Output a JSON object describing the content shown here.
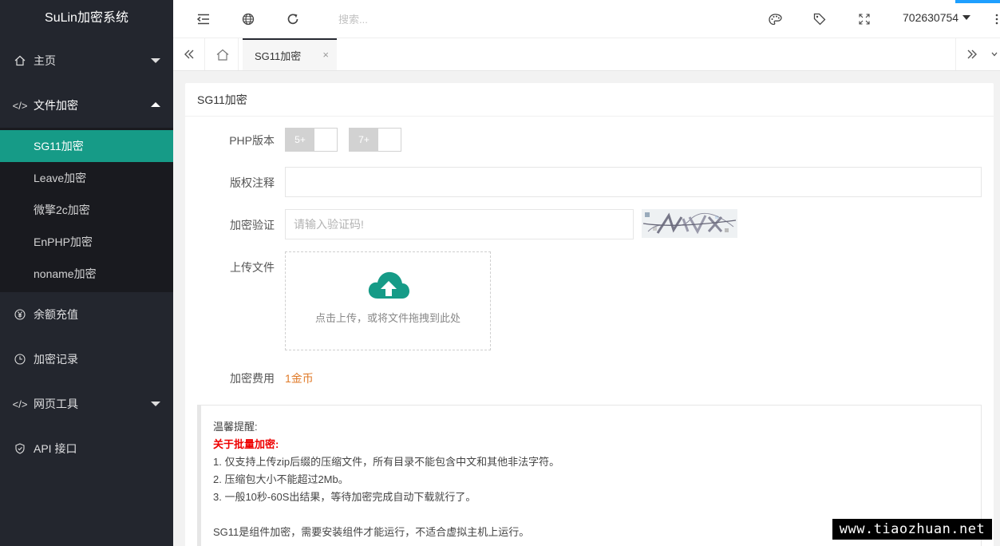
{
  "app": {
    "title": "SuLin加密系统"
  },
  "sidebar": {
    "items": [
      {
        "label": "主页",
        "icon": "home-icon"
      },
      {
        "label": "文件加密",
        "icon": "code-icon"
      },
      {
        "label": "余额充值",
        "icon": "yen-icon"
      },
      {
        "label": "加密记录",
        "icon": "clock-icon"
      },
      {
        "label": "网页工具",
        "icon": "code-icon"
      },
      {
        "label": "API 接口",
        "icon": "shield-icon"
      }
    ],
    "submenu": [
      "SG11加密",
      "Leave加密",
      "微擎2c加密",
      "EnPHP加密",
      "noname加密"
    ],
    "active_sub": "SG11加密",
    "accent_color": "#169b87"
  },
  "header": {
    "search_placeholder": "搜索...",
    "user": "702630754"
  },
  "tabs": {
    "items": [
      {
        "label": "SG11加密",
        "close": "×"
      }
    ]
  },
  "card": {
    "title": "SG11加密",
    "php_label": "PHP版本",
    "php_options": [
      "5+",
      "7+"
    ],
    "copyright_label": "版权注释",
    "copyright_value": "",
    "verify_label": "加密验证",
    "verify_placeholder": "请输入验证码!",
    "upload_label": "上传文件",
    "upload_text": "点击上传，或将文件拖拽到此处",
    "fee_label": "加密费用",
    "fee_value": "1金币"
  },
  "tips": {
    "title": "温馨提醒:",
    "subtitle": "关于批量加密:",
    "lines": [
      "1. 仅支持上传zip后缀的压缩文件，所有目录不能包含中文和其他非法字符。",
      "2. 压缩包大小不能超过2Mb。",
      "3. 一般10秒-60S出结果，等待加密完成自动下载就行了。"
    ],
    "note": "SG11是组件加密，需要安装组件才能运行，不适合虚拟主机上运行。"
  },
  "watermark": "www.tiaozhuan.net"
}
